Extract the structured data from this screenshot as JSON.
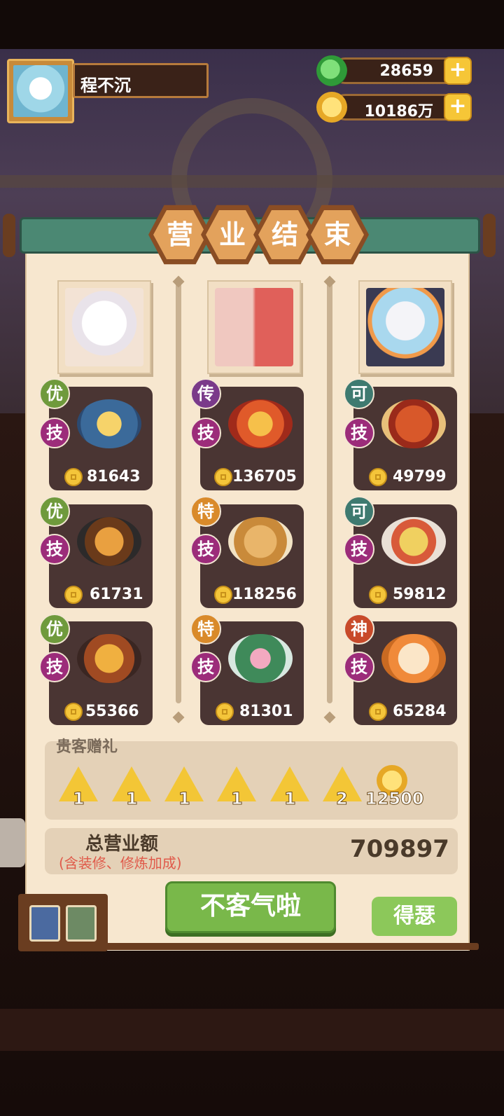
{
  "player": {
    "name": "程不沉",
    "avatar_icon": "panda-chef-avatar-icon"
  },
  "resources": {
    "jade": {
      "value": "28659",
      "icon": "jade-coin-icon"
    },
    "gold": {
      "value": "10186万",
      "icon": "gold-coin-icon"
    },
    "plus": "+"
  },
  "title": [
    "营",
    "业",
    "结",
    "束"
  ],
  "columns": [
    {
      "chef_icon": "white-cat-chef-portrait",
      "dishes": [
        {
          "grade": "优",
          "skill": "技",
          "price": "81643",
          "icon": "hotpot-dish-icon"
        },
        {
          "grade": "优",
          "skill": "技",
          "price": "61731",
          "icon": "burger-fries-dish-icon"
        },
        {
          "grade": "优",
          "skill": "技",
          "price": "55366",
          "icon": "fried-fish-dish-icon"
        }
      ]
    },
    {
      "chef_icon": "twin-girls-chef-portrait",
      "dishes": [
        {
          "grade": "传",
          "skill": "技",
          "price": "136705",
          "icon": "festival-hotpot-dish-icon"
        },
        {
          "grade": "特",
          "skill": "技",
          "price": "118256",
          "icon": "mushroom-soup-dish-icon"
        },
        {
          "grade": "特",
          "skill": "技",
          "price": "81301",
          "icon": "lotus-jelly-dish-icon"
        }
      ]
    },
    {
      "chef_icon": "white-hair-boy-chef-portrait",
      "dishes": [
        {
          "grade": "可",
          "skill": "技",
          "price": "49799",
          "icon": "braised-crab-dish-icon"
        },
        {
          "grade": "可",
          "skill": "技",
          "price": "59812",
          "icon": "curry-bowl-dish-icon"
        },
        {
          "grade": "神",
          "skill": "技",
          "price": "65284",
          "icon": "shrimp-rice-dish-icon"
        }
      ]
    }
  ],
  "gifts": {
    "label": "贵客赠礼",
    "items": [
      {
        "count": "1",
        "icon": "spiral-token-icon"
      },
      {
        "count": "1",
        "icon": "spiral-token-icon"
      },
      {
        "count": "1",
        "icon": "flame-token-icon"
      },
      {
        "count": "1",
        "icon": "knot-token-icon"
      },
      {
        "count": "1",
        "icon": "star-token-icon"
      },
      {
        "count": "2",
        "icon": "star-token-icon"
      }
    ],
    "coin_count": "12500",
    "coin_icon": "gold-coin-icon"
  },
  "total": {
    "label": "总营业额",
    "sublabel": "(含装修、修炼加成)",
    "value": "709897"
  },
  "buttons": {
    "main": "不客气啦",
    "secondary": "得瑟"
  },
  "colors": {
    "grade_you": "#6f9a3c",
    "grade_chuan": "#7a3a8a",
    "grade_te": "#d98a2a",
    "grade_ke": "#3e7a70",
    "grade_shen": "#c84a2a",
    "skill": "#9c2c7a"
  }
}
